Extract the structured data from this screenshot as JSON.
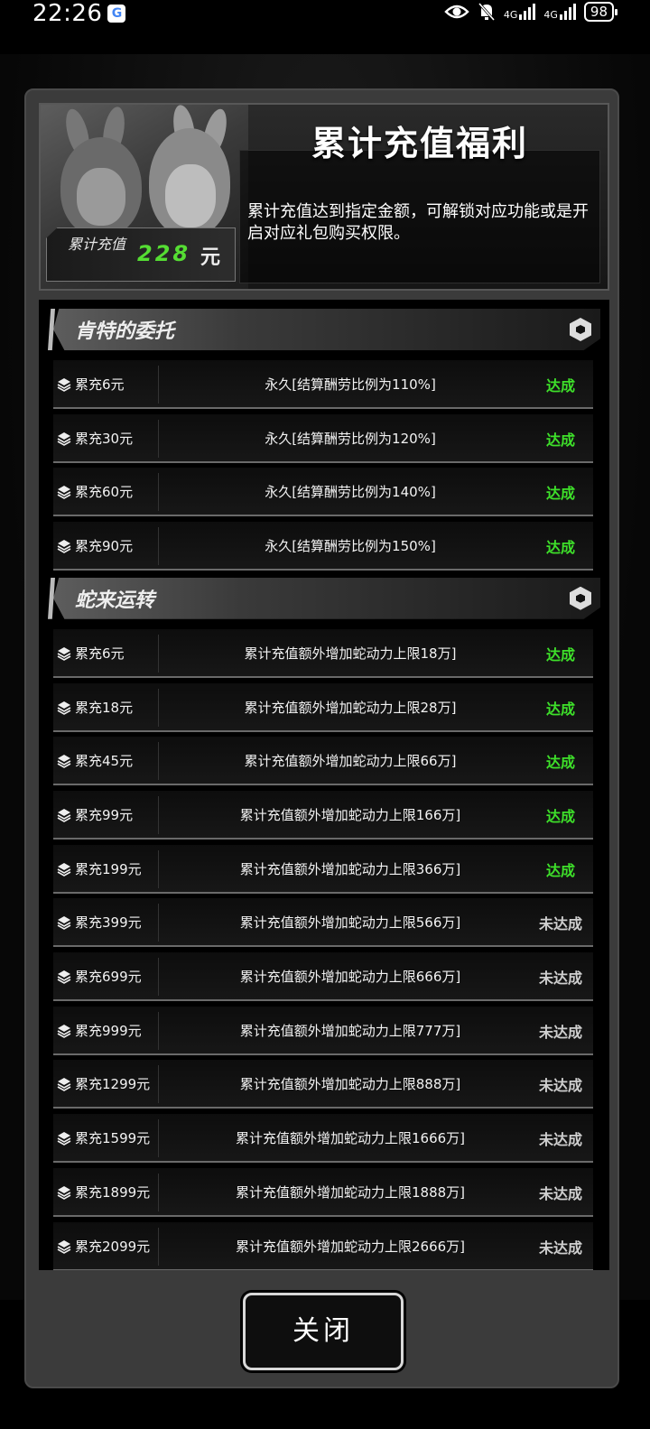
{
  "status_bar": {
    "time": "22:26",
    "g_badge": "G",
    "net1": "4G",
    "net2": "4G",
    "battery": "98"
  },
  "header": {
    "title": "累计充值福利",
    "description": "累计充值达到指定金额，可解锁对应功能或是开启对应礼包购买权限。",
    "total_label": "累计充值",
    "total_value": "228",
    "total_unit": "元"
  },
  "sections": [
    {
      "title": "肯特的委托",
      "rows": [
        {
          "amount": "累充6元",
          "desc": "永久[结算酬劳比例为110%]",
          "status": "达成"
        },
        {
          "amount": "累充30元",
          "desc": "永久[结算酬劳比例为120%]",
          "status": "达成"
        },
        {
          "amount": "累充60元",
          "desc": "永久[结算酬劳比例为140%]",
          "status": "达成"
        },
        {
          "amount": "累充90元",
          "desc": "永久[结算酬劳比例为150%]",
          "status": "达成"
        }
      ]
    },
    {
      "title": "蛇来运转",
      "rows": [
        {
          "amount": "累充6元",
          "desc": "累计充值额外增加蛇动力上限18万]",
          "status": "达成"
        },
        {
          "amount": "累充18元",
          "desc": "累计充值额外增加蛇动力上限28万]",
          "status": "达成"
        },
        {
          "amount": "累充45元",
          "desc": "累计充值额外增加蛇动力上限66万]",
          "status": "达成"
        },
        {
          "amount": "累充99元",
          "desc": "累计充值额外增加蛇动力上限166万]",
          "status": "达成"
        },
        {
          "amount": "累充199元",
          "desc": "累计充值额外增加蛇动力上限366万]",
          "status": "达成"
        },
        {
          "amount": "累充399元",
          "desc": "累计充值额外增加蛇动力上限566万]",
          "status": "未达成"
        },
        {
          "amount": "累充699元",
          "desc": "累计充值额外增加蛇动力上限666万]",
          "status": "未达成"
        },
        {
          "amount": "累充999元",
          "desc": "累计充值额外增加蛇动力上限777万]",
          "status": "未达成"
        },
        {
          "amount": "累充1299元",
          "desc": "累计充值额外增加蛇动力上限888万]",
          "status": "未达成"
        },
        {
          "amount": "累充1599元",
          "desc": "累计充值额外增加蛇动力上限1666万]",
          "status": "未达成"
        },
        {
          "amount": "累充1899元",
          "desc": "累计充值额外增加蛇动力上限1888万]",
          "status": "未达成"
        },
        {
          "amount": "累充2099元",
          "desc": "累计充值额外增加蛇动力上限2666万]",
          "status": "未达成"
        }
      ]
    }
  ],
  "footer": {
    "close_label": "关闭"
  }
}
